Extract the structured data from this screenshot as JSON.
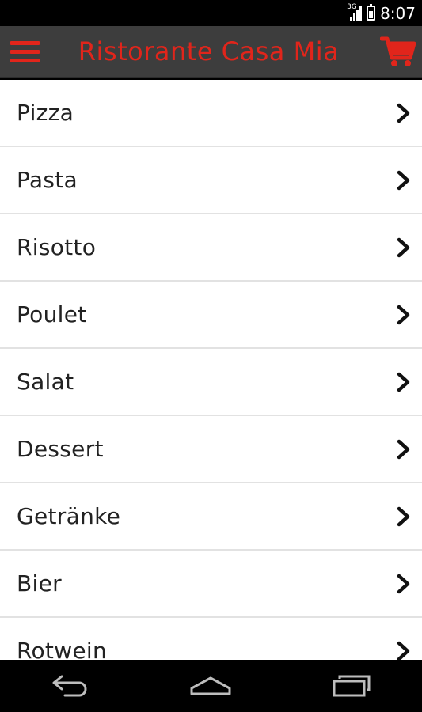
{
  "status_bar": {
    "network": "3G",
    "time": "8:07"
  },
  "app_bar": {
    "title": "Ristorante Casa Mia",
    "menu_icon": "hamburger-menu-icon",
    "cart_icon": "shopping-cart-icon"
  },
  "colors": {
    "accent": "#e1251b",
    "app_bar_bg": "#3d3d3d",
    "list_bg": "#ffffff",
    "divider": "#e2e2e2"
  },
  "categories": [
    {
      "label": "Pizza"
    },
    {
      "label": "Pasta"
    },
    {
      "label": "Risotto"
    },
    {
      "label": "Poulet"
    },
    {
      "label": "Salat"
    },
    {
      "label": "Dessert"
    },
    {
      "label": "Getränke"
    },
    {
      "label": "Bier"
    },
    {
      "label": "Rotwein"
    }
  ],
  "nav_bar": {
    "back_icon": "back-icon",
    "home_icon": "home-icon",
    "recents_icon": "recent-apps-icon"
  }
}
